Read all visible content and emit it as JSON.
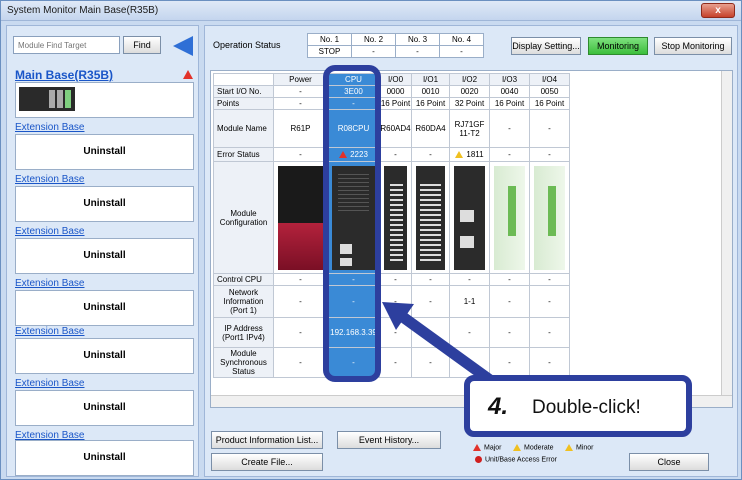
{
  "window": {
    "title": "System Monitor Main Base(R35B)",
    "close_label": "x"
  },
  "left_panel": {
    "find_placeholder": "Module Find Target",
    "find_label": "Find",
    "main_base_label": "Main Base(R35B)",
    "extension_label": "Extension Base",
    "uninstall_label": "Uninstall",
    "extensions": [
      "Extension Base",
      "Extension Base",
      "Extension Base",
      "Extension Base",
      "Extension Base",
      "Extension Base",
      "Extension Base"
    ]
  },
  "operation_status": {
    "label": "Operation Status",
    "headers": [
      "No. 1",
      "No. 2",
      "No. 3",
      "No. 4"
    ],
    "values": [
      "STOP",
      "-",
      "-",
      "-"
    ]
  },
  "toolbar": {
    "display_setting": "Display Setting...",
    "monitoring": "Monitoring",
    "stop_monitoring": "Stop Monitoring"
  },
  "grid": {
    "columns": [
      "Power",
      "CPU",
      "I/O0",
      "I/O1",
      "I/O2",
      "I/O3",
      "I/O4"
    ],
    "row_labels": {
      "start_io": "Start I/O No.",
      "points": "Points",
      "module_name": "Module Name",
      "error_status": "Error Status",
      "module_config": "Module Configuration",
      "control_cpu": "Control CPU",
      "network_info": "Network Information (Port 1)",
      "ip_address": "IP Address (Port1 IPv4)",
      "module_sync": "Module Synchronous Status"
    },
    "start_io": [
      "-",
      "3E00",
      "0000",
      "0010",
      "0020",
      "0040",
      "0050"
    ],
    "points": [
      "-",
      "-",
      "16 Point",
      "16 Point",
      "32 Point",
      "16 Point",
      "16 Point"
    ],
    "module_name": [
      "R61P",
      "R08CPU",
      "R60AD4",
      "R60DA4",
      "RJ71GF 11-T2",
      "-",
      "-"
    ],
    "error_status": [
      "-",
      "2223",
      "-",
      "-",
      "1811",
      "-",
      "-"
    ],
    "control_cpu": [
      "-",
      "-",
      "-",
      "-",
      "-",
      "-",
      "-"
    ],
    "network_info": [
      "-",
      "-",
      "-",
      "-",
      "1-1",
      "-",
      "-"
    ],
    "ip_address": [
      "-",
      "192.168.3.39",
      "-",
      "-",
      "-",
      "-",
      "-"
    ],
    "module_sync": [
      "-",
      "-",
      "-",
      "-",
      "-",
      "-",
      "-"
    ]
  },
  "bottom": {
    "product_info": "Product Information List...",
    "event_history": "Event History...",
    "create_file": "Create File...",
    "close": "Close"
  },
  "legend": {
    "major": "Major",
    "moderate": "Moderate",
    "minor": "Minor",
    "access_error": "Unit/Base Access Error"
  },
  "callout": {
    "step": "4.",
    "text": "Double-click!"
  },
  "colors": {
    "accent": "#2d3f9e",
    "cpu_highlight": "#3a8ad6",
    "monitoring": "#3cbf3c"
  }
}
